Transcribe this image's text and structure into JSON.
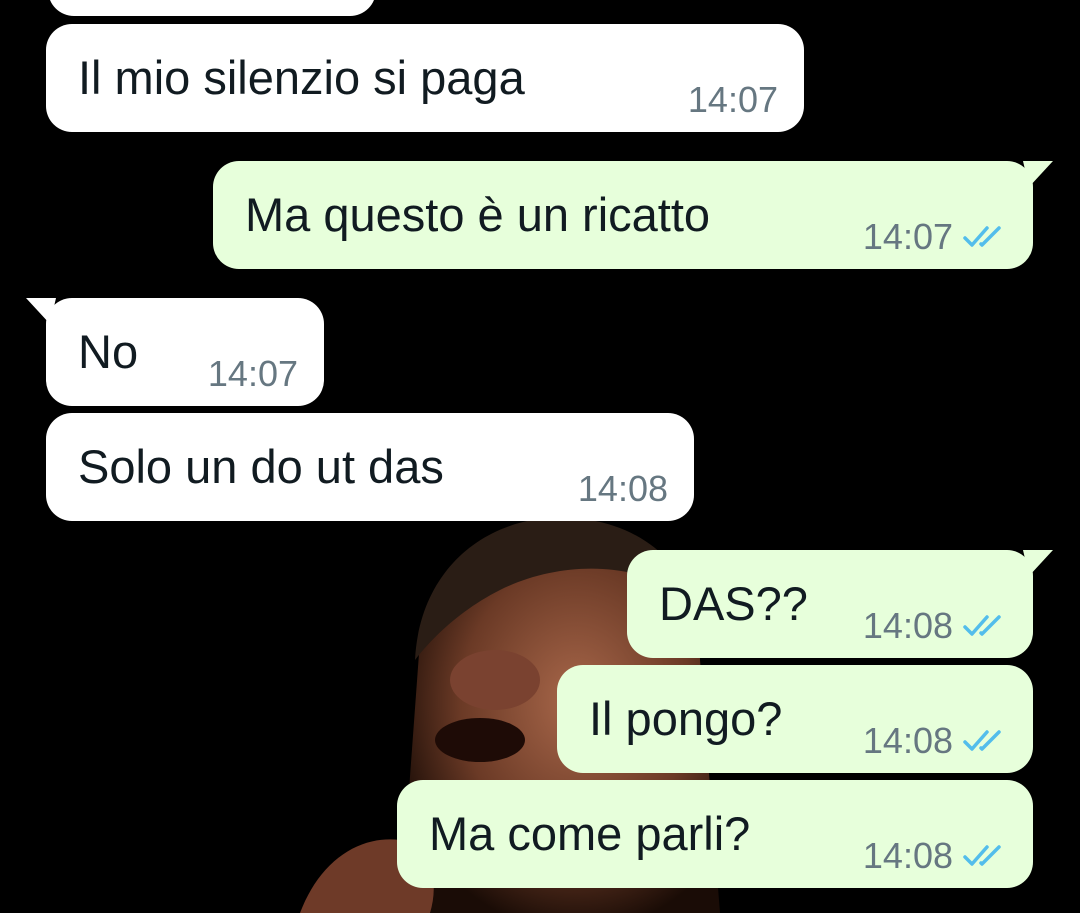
{
  "messages": [
    {
      "text": "Il mio silenzio si paga",
      "time": "14:07",
      "direction": "incoming",
      "read": false
    },
    {
      "text": "Ma questo è un ricatto",
      "time": "14:07",
      "direction": "outgoing",
      "read": true
    },
    {
      "text": "No",
      "time": "14:07",
      "direction": "incoming",
      "read": false
    },
    {
      "text": "Solo un do ut das",
      "time": "14:08",
      "direction": "incoming",
      "read": false
    },
    {
      "text": "DAS??",
      "time": "14:08",
      "direction": "outgoing",
      "read": true
    },
    {
      "text": "Il pongo?",
      "time": "14:08",
      "direction": "outgoing",
      "read": true
    },
    {
      "text": "Ma come parli?",
      "time": "14:08",
      "direction": "outgoing",
      "read": true
    }
  ],
  "colors": {
    "chat_background": "#000000",
    "incoming_bubble": "#ffffff",
    "outgoing_bubble": "#e7ffdb",
    "message_text": "#111b21",
    "timestamp": "#667781",
    "read_ticks": "#53bdeb"
  },
  "icons": {
    "read_receipt": "double-check-icon"
  }
}
